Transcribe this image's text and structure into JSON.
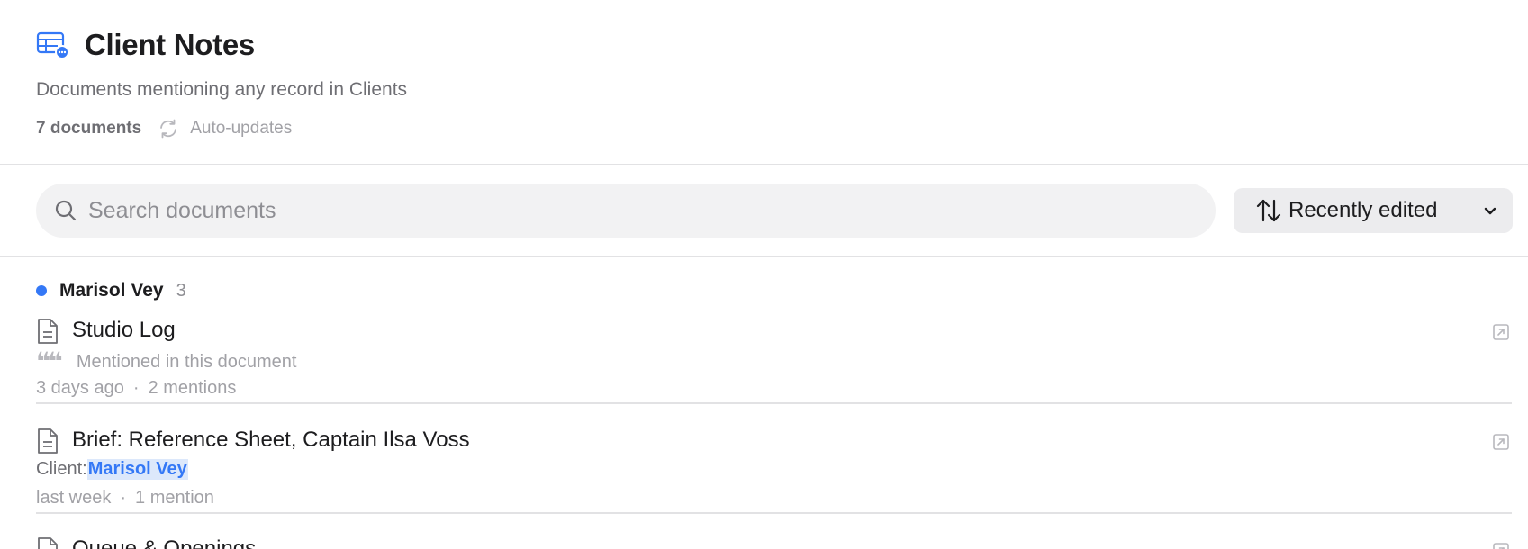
{
  "header": {
    "title": "Client Notes",
    "subtitle": "Documents mentioning any record in Clients",
    "doc_count": "7 documents",
    "auto_updates": "Auto-updates",
    "icon": "table-icon"
  },
  "toolbar": {
    "search_placeholder": "Search documents",
    "search_value": "",
    "sort_label": "Recently edited"
  },
  "groups": [
    {
      "name": "Marisol Vey",
      "count": "3",
      "dot_color": "#3478f6",
      "documents": [
        {
          "title": "Studio Log",
          "snippet": "Mentioned in this document",
          "time": "3 days ago",
          "sep": "·",
          "mentions": "2 mentions"
        },
        {
          "title": "Brief: Reference Sheet, Captain Ilsa Voss",
          "snippet_prefix": "Client: ",
          "snippet_highlight": "Marisol Vey",
          "time": "last week",
          "sep": "·",
          "mentions": "1 mention"
        },
        {
          "title": "Queue & Openings"
        }
      ]
    }
  ],
  "colors": {
    "accent": "#3478f6",
    "highlight_bg": "#dce8fb",
    "muted_text": "#a1a1a6"
  }
}
